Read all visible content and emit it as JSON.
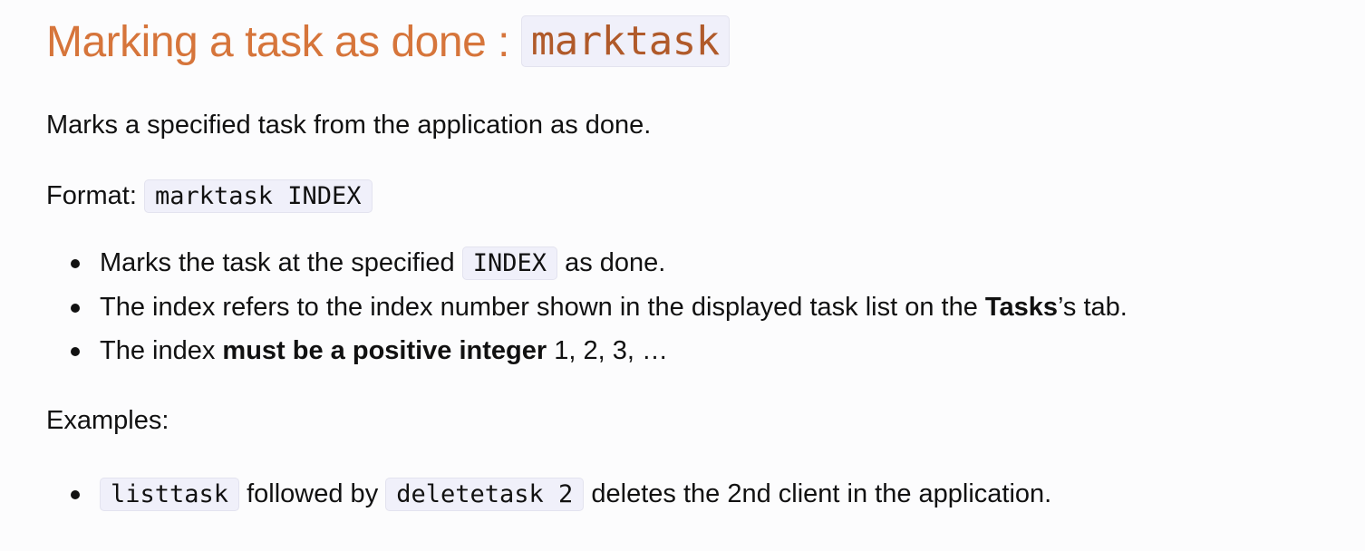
{
  "heading": {
    "text": "Marking a task as done : ",
    "command": "marktask"
  },
  "description": "Marks a specified task from the application as done.",
  "format": {
    "label": "Format: ",
    "code": "marktask INDEX"
  },
  "points": [
    {
      "before": "Marks the task at the specified ",
      "code": "INDEX",
      "after": " as done."
    },
    {
      "before": "The index refers to the index number shown in the displayed task list on the ",
      "bold": "Tasks",
      "after": "’s tab."
    },
    {
      "before": "The index ",
      "bold": "must be a positive integer",
      "after": " 1, 2, 3, …"
    }
  ],
  "examples": {
    "label": "Examples:",
    "items": [
      {
        "code1": "listtask",
        "middle": " followed by ",
        "code2": "deletetask 2",
        "after": " deletes the 2nd client in the application."
      }
    ]
  },
  "colors": {
    "heading": "#d6753b",
    "code_background": "#f0f0fa",
    "code_border": "#e3e3ef",
    "text": "#111111",
    "page_background": "#fcfcfd"
  }
}
